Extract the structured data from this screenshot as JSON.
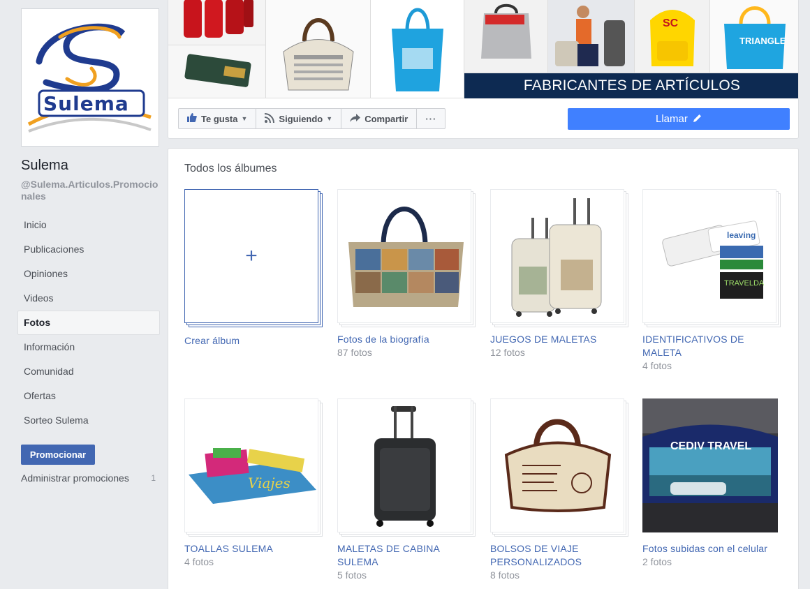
{
  "page": {
    "name": "Sulema",
    "handle": "@Sulema.Articulos.Promocionales",
    "logo_text": "Sulema"
  },
  "nav": {
    "items": [
      {
        "label": "Inicio",
        "active": false
      },
      {
        "label": "Publicaciones",
        "active": false
      },
      {
        "label": "Opiniones",
        "active": false
      },
      {
        "label": "Videos",
        "active": false
      },
      {
        "label": "Fotos",
        "active": true
      },
      {
        "label": "Información",
        "active": false
      },
      {
        "label": "Comunidad",
        "active": false
      },
      {
        "label": "Ofertas",
        "active": false
      },
      {
        "label": "Sorteo Sulema",
        "active": false
      }
    ],
    "promote_label": "Promocionar",
    "manage_promotions_label": "Administrar promociones",
    "manage_promotions_count": "1"
  },
  "cover": {
    "banner_text": "FABRICANTES DE ARTÍCULOS PROMOCIONALES",
    "badges": [
      "SC",
      "TRIANGLE"
    ]
  },
  "actions": {
    "like_label": "Te gusta",
    "following_label": "Siguiendo",
    "share_label": "Compartir",
    "more_label": "···",
    "call_label": "Llamar"
  },
  "albums": {
    "title": "Todos los álbumes",
    "create_label": "Crear álbum",
    "items": [
      {
        "name": "Fotos de la biografía",
        "count": "87 fotos"
      },
      {
        "name": "JUEGOS DE MALETAS",
        "count": "12 fotos"
      },
      {
        "name": "IDENTIFICATIVOS DE MALETA",
        "count": "4 fotos"
      },
      {
        "name": "TOALLAS SULEMA",
        "count": "4 fotos"
      },
      {
        "name": "MALETAS DE CABINA SULEMA",
        "count": "5 fotos"
      },
      {
        "name": "BOLSOS DE VIAJE PERSONALIZADOS",
        "count": "8 fotos"
      },
      {
        "name": "Fotos subidas con el celular",
        "count": "2 fotos"
      }
    ],
    "thumb_texts": {
      "tag_brand": "leaving",
      "tag_brand2": "TRAVELDA",
      "towel_text": "Viajes",
      "bag_text": "CEDIV TRAVEL"
    }
  },
  "colors": {
    "link_blue": "#4267b2",
    "call_blue": "#4080ff",
    "banner_navy": "#0d2a52",
    "bg": "#e9ebee"
  }
}
